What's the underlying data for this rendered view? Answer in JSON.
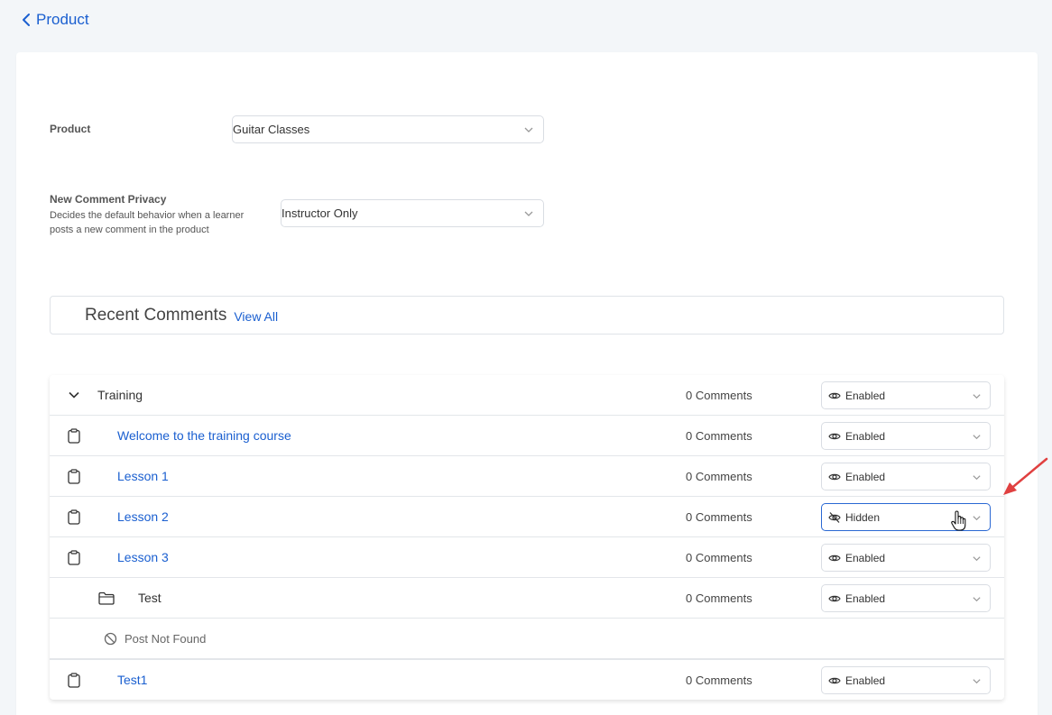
{
  "header": {
    "back_label": "Product"
  },
  "form": {
    "product_label": "Product",
    "product_value": "Guitar Classes",
    "privacy_label": "New Comment Privacy",
    "privacy_desc": "Decides the default behavior when a learner posts a new comment in the product",
    "privacy_value": "Instructor Only"
  },
  "recent": {
    "title": "Recent Comments",
    "view_all": "View All"
  },
  "rows": [
    {
      "name": "Training",
      "count": "0 Comments",
      "visibility": "Enabled"
    },
    {
      "name": "Welcome to the training course",
      "count": "0 Comments",
      "visibility": "Enabled"
    },
    {
      "name": "Lesson 1",
      "count": "0 Comments",
      "visibility": "Enabled"
    },
    {
      "name": "Lesson 2",
      "count": "0 Comments",
      "visibility": "Hidden"
    },
    {
      "name": "Lesson 3",
      "count": "0 Comments",
      "visibility": "Enabled"
    },
    {
      "name": "Test",
      "count": "0 Comments",
      "visibility": "Enabled"
    },
    {
      "name": "Post Not Found"
    },
    {
      "name": "Test1",
      "count": "0 Comments",
      "visibility": "Enabled"
    }
  ],
  "colors": {
    "accent": "#1a5fd0",
    "arrow": "#e04040"
  }
}
